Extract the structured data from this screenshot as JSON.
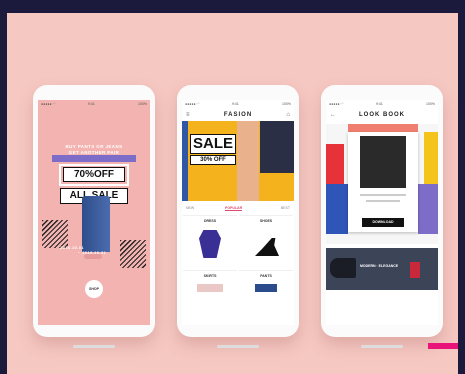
{
  "phones": [
    {
      "status": {
        "left": "●●●●● ◠",
        "time": "9:41",
        "battery": "100%"
      },
      "title": "",
      "promo_line1": "BUY PANTS OR JEANS",
      "promo_line2": "GET ANOTHER PAIR",
      "offer": "70%OFF",
      "sale": "ALL SALE",
      "date_line1": "2016.10.01",
      "date_line2": "~ 2016.10.31",
      "cta": "SHOP"
    },
    {
      "status": {
        "left": "●●●●● ◠",
        "time": "9:41",
        "battery": "100%"
      },
      "title": "FASION",
      "sale": "SALE",
      "offer": "30% OFF",
      "tabs": [
        "NEW",
        "POPULAR",
        "BEST"
      ],
      "products": [
        "DRESS",
        "SHOES",
        "SKIRTS",
        "PANTS"
      ]
    },
    {
      "status": {
        "left": "●●●●● ◠",
        "time": "9:41",
        "battery": "100%"
      },
      "title": "LOOK BOOK",
      "download": "DOWNLOAD",
      "banner": "MODERN · ELEGANCE"
    }
  ]
}
